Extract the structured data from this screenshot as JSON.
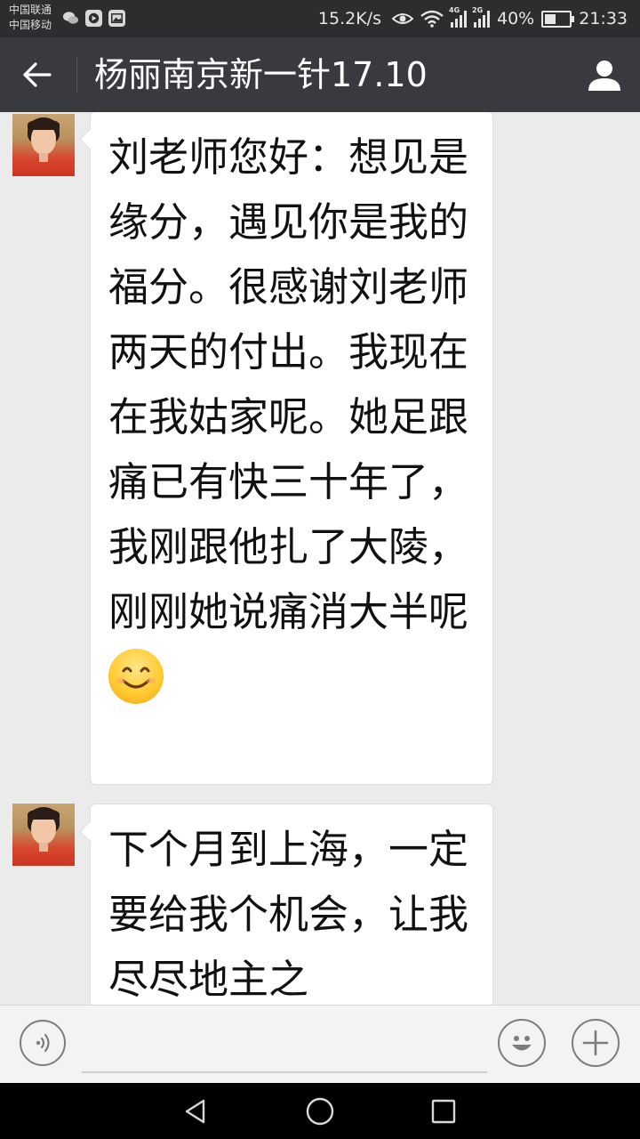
{
  "status_bar": {
    "carrier_1": "中国联通",
    "carrier_2": "中国移动",
    "app_icons": [
      "wechat-icon",
      "video-app-icon",
      "photo-app-icon"
    ],
    "net_speed": "15.2K/s",
    "network_tag_1": "4G",
    "network_tag_2": "2G",
    "battery_percent": "40%",
    "battery_level": 0.4,
    "time": "21:33"
  },
  "header": {
    "title": "杨丽南京新一针17.10",
    "back_icon": "arrow-left-icon",
    "profile_icon": "person-icon"
  },
  "messages": [
    {
      "sender": "contact",
      "text": "刘老师您好：想见是缘分，遇见你是我的福分。很感谢刘老师两天的付出。我现在在我姑家呢。她足跟痛已有快三十年了，我刚跟他扎了大陵，刚刚她说痛消大半呢",
      "trailing_emoji": "smiling-face-emoji"
    },
    {
      "sender": "contact",
      "text": "下个月到上海，一定要给我个机会，让我尽尽地主之"
    }
  ],
  "input_bar": {
    "voice_icon": "voice-icon",
    "message_value": "",
    "emoji_icon": "emoji-icon",
    "more_icon": "plus-icon"
  },
  "nav_bar": {
    "back_icon": "nav-back-icon",
    "home_icon": "nav-home-icon",
    "recents_icon": "nav-recents-icon"
  },
  "colors": {
    "status_bar_bg": "#2b2d2f",
    "title_bar_bg": "#393a3f",
    "chat_bg": "#ebebeb",
    "bubble_bg": "#ffffff"
  }
}
